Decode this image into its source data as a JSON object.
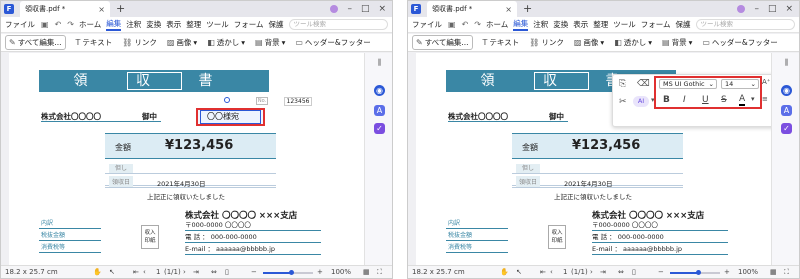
{
  "panes": {
    "left": {
      "tab": "領収書.pdf *",
      "menu": {
        "file": "ファイル",
        "items": [
          "ホーム",
          "編集",
          "注釈",
          "変換",
          "表示",
          "整理",
          "ツール",
          "フォーム",
          "保護"
        ],
        "active": "編集",
        "search_placeholder": "ツール検索"
      },
      "toolbar": [
        "すべて編集...",
        "テキスト",
        "リンク",
        "画像",
        "透かし",
        "背景",
        "ヘッダー&フッター"
      ]
    },
    "right": {
      "tab": "領収書.pdf *",
      "menu": {
        "file": "ファイル",
        "items": [
          "ホーム",
          "編集",
          "注釈",
          "変換",
          "表示",
          "整理",
          "ツール",
          "フォーム",
          "保護"
        ],
        "active": "編集",
        "search_placeholder": "ツール検索"
      },
      "toolbar": [
        "すべて編集...",
        "テキスト",
        "リンク",
        "画像",
        "透かし",
        "背景",
        "ヘッダー&フッター"
      ]
    }
  },
  "document": {
    "title": "領 収 書",
    "no_label": "No.",
    "no_value": "123456",
    "addressee": "株式会社〇〇〇〇",
    "onchu": "御中",
    "honorific": "〇〇様宛",
    "amount_label": "金額",
    "amount_value": "¥123,456",
    "row_labels": [
      "但し",
      "",
      "領収日"
    ],
    "date": "2021年4月30日",
    "confirm": "上記正に領収いたしました",
    "left_fields": [
      "内訳",
      "税抜金額",
      "消費税等"
    ],
    "stamp": "収入\n印紙",
    "company": "株式会社 〇〇〇〇 ×××支店",
    "zip": "〒000-0000 〇〇〇〇",
    "tel": "電 話 ： 000-000-0000",
    "email": "E-mail ： aaaaaa@bbbbb.jp"
  },
  "format_panel": {
    "font": "MS UI Gothic",
    "size": "14",
    "ai_label": "AI",
    "styles": [
      "B",
      "I",
      "U",
      "S",
      "A"
    ]
  },
  "status": {
    "page_size": "18.2 x 25.7 cm",
    "page": "1",
    "page_total": "(1/1)",
    "zoom": "100%"
  }
}
